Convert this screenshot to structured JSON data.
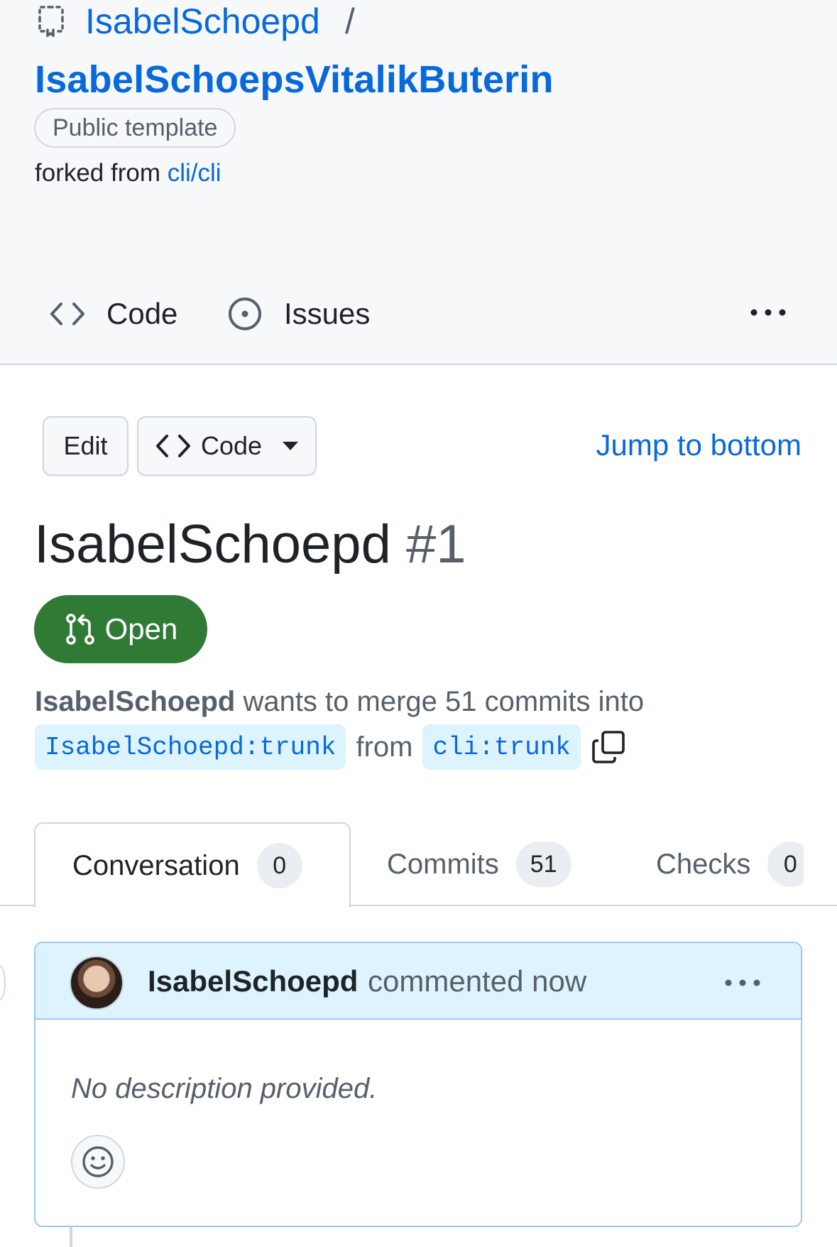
{
  "repo": {
    "owner": "IsabelSchoepd",
    "separator": "/",
    "name": "IsabelSchoepsVitalikButerin",
    "visibility_badge": "Public template",
    "forked_prefix": "forked from",
    "forked_source": "cli/cli",
    "icon": "repo-template-icon"
  },
  "nav": {
    "items": [
      {
        "label": "Code",
        "icon": "code-icon"
      },
      {
        "label": "Issues",
        "icon": "issue-opened-icon"
      }
    ],
    "more_icon": "kebab-horizontal-icon"
  },
  "toolbar": {
    "edit_label": "Edit",
    "code_label": "Code",
    "jump_label": "Jump to bottom"
  },
  "pr": {
    "title": "IsabelSchoepd",
    "number": "#1",
    "state": "Open",
    "state_color": "#2f7a35",
    "author": "IsabelSchoepd",
    "merge_text": "wants to merge 51 commits into",
    "base_ref": "IsabelSchoepd:trunk",
    "from_word": "from",
    "head_ref": "cli:trunk"
  },
  "tabs": [
    {
      "label": "Conversation",
      "count": "0",
      "selected": true
    },
    {
      "label": "Commits",
      "count": "51",
      "selected": false
    },
    {
      "label": "Checks",
      "count": "0",
      "selected": false
    }
  ],
  "comment": {
    "author": "IsabelSchoepd",
    "meta": "commented now",
    "body": "No description provided.",
    "reaction_icon": "smiley-icon"
  },
  "colors": {
    "link": "#0969da",
    "open_green": "#2f7a35",
    "comment_header_bg": "#ddf4ff"
  }
}
